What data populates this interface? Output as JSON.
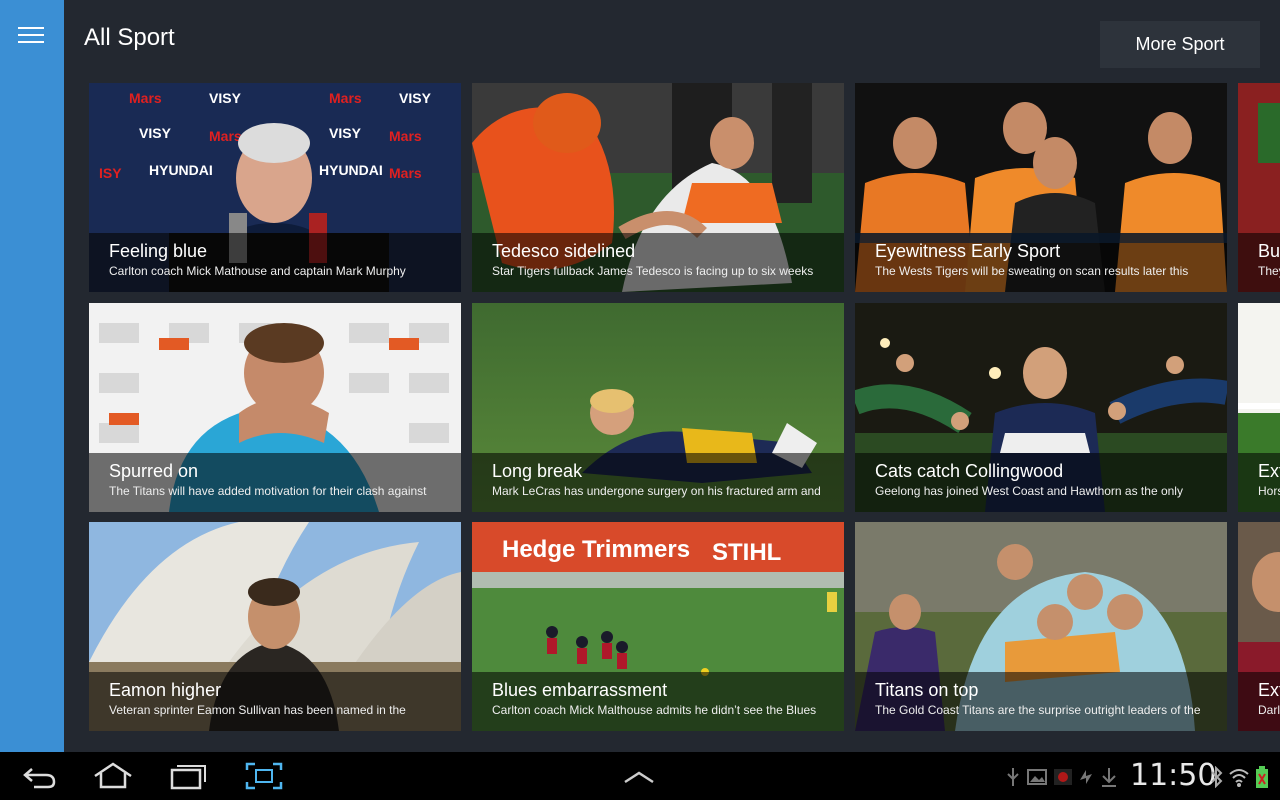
{
  "header": {
    "title": "All Sport",
    "more_button": "More Sport"
  },
  "tiles": [
    {
      "headline": "Feeling blue",
      "summary": "Carlton coach Mick Mathouse and captain Mark Murphy"
    },
    {
      "headline": "Tedesco sidelined",
      "summary": "Star Tigers fullback James Tedesco is facing up to six weeks"
    },
    {
      "headline": "Eyewitness Early Sport",
      "summary": "The Wests Tigers will be sweating on scan results later this"
    },
    {
      "headline": "Bu",
      "summary": "They"
    },
    {
      "headline": "Spurred on",
      "summary": "The Titans will have added motivation for their clash against"
    },
    {
      "headline": "Long break",
      "summary": "Mark LeCras has undergone surgery on his fractured arm and"
    },
    {
      "headline": "Cats catch Collingwood",
      "summary": "Geelong has joined West Coast and Hawthorn as the only"
    },
    {
      "headline": "Ext",
      "summary": "Hors"
    },
    {
      "headline": "Eamon higher",
      "summary": "Veteran sprinter Eamon Sullivan has been named in the"
    },
    {
      "headline": "Blues embarrassment",
      "summary": "Carlton coach Mick Malthouse admits he didn’t see the Blues"
    },
    {
      "headline": "Titans on top",
      "summary": "The Gold Coast Titans are the surprise outright leaders of the"
    },
    {
      "headline": "Ext",
      "summary": "Darl"
    }
  ],
  "status_bar": {
    "time": "11:50"
  },
  "icons": {
    "menu": "hamburger-menu-icon",
    "back": "back-icon",
    "home": "home-icon",
    "recent": "recent-apps-icon",
    "screenshot": "screenshot-icon",
    "up": "chevron-up-icon"
  },
  "colors": {
    "rail": "#3b8fd4",
    "background": "#232830",
    "button": "#2d333b"
  }
}
